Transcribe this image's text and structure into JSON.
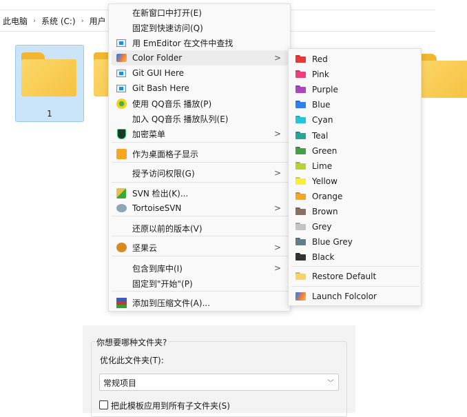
{
  "explorer": {
    "breadcrumb": [
      "此电脑",
      "系统 (C:)",
      "用户"
    ],
    "folders": [
      {
        "name": "1",
        "selected": true
      }
    ]
  },
  "context_menu": {
    "items": [
      {
        "label": "在新窗口中打开(E)",
        "icon": ""
      },
      {
        "label": "固定到快速访问(Q)",
        "icon": ""
      },
      {
        "label": "用 EmEditor 在文件中查找",
        "icon": "emeditor-icon"
      },
      {
        "label": "Color Folder",
        "icon": "color-folder-icon",
        "submenu": true,
        "highlighted": true
      },
      {
        "label": "Git GUI Here",
        "icon": "git-gui-icon"
      },
      {
        "label": "Git Bash Here",
        "icon": "git-bash-icon"
      },
      {
        "label": "使用 QQ音乐 播放(P)",
        "icon": "qq-music-icon"
      },
      {
        "label": "加入 QQ音乐 播放队列(E)",
        "icon": ""
      },
      {
        "label": "加密菜单",
        "icon": "encrypt-icon",
        "submenu": true
      },
      {
        "label": "作为桌面格子显示",
        "icon": "desktop-grid-icon"
      },
      {
        "label": "授予访问权限(G)",
        "icon": "",
        "submenu": true
      },
      {
        "label": "SVN 检出(K)...",
        "icon": "svn-checkout-icon"
      },
      {
        "label": "TortoiseSVN",
        "icon": "tortoisesvn-icon",
        "submenu": true
      },
      {
        "label": "还原以前的版本(V)",
        "icon": ""
      },
      {
        "label": "坚果云",
        "icon": "nutstore-icon",
        "submenu": true
      },
      {
        "label": "包含到库中(I)",
        "icon": "",
        "submenu": true
      },
      {
        "label": "固定到\"开始\"(P)",
        "icon": ""
      },
      {
        "label": "添加到压缩文件(A)...",
        "icon": "winrar-icon"
      }
    ],
    "arrow": ">"
  },
  "color_submenu": {
    "colors": [
      {
        "label": "Red",
        "color": "#e53935"
      },
      {
        "label": "Pink",
        "color": "#ec407a"
      },
      {
        "label": "Purple",
        "color": "#ab47bc"
      },
      {
        "label": "Blue",
        "color": "#2f80ed"
      },
      {
        "label": "Cyan",
        "color": "#26c6da"
      },
      {
        "label": "Teal",
        "color": "#26a69a"
      },
      {
        "label": "Green",
        "color": "#43a047"
      },
      {
        "label": "Lime",
        "color": "#b5d334"
      },
      {
        "label": "Yellow",
        "color": "#f7ee3a"
      },
      {
        "label": "Orange",
        "color": "#f5a623"
      },
      {
        "label": "Brown",
        "color": "#8d6e63"
      },
      {
        "label": "Grey",
        "color": "#c4c4c4"
      },
      {
        "label": "Blue Grey",
        "color": "#607d8b"
      },
      {
        "label": "Black",
        "color": "#333333"
      }
    ],
    "restore": "Restore Default",
    "launch": "Launch Folcolor"
  },
  "dialog": {
    "group_label": "你想要哪种文件夹?",
    "optimize_label": "优化此文件夹(T):",
    "select_value": "常规项目",
    "checkbox_label": "把此模板应用到所有子文件夹(S)",
    "checkbox_checked": false
  }
}
